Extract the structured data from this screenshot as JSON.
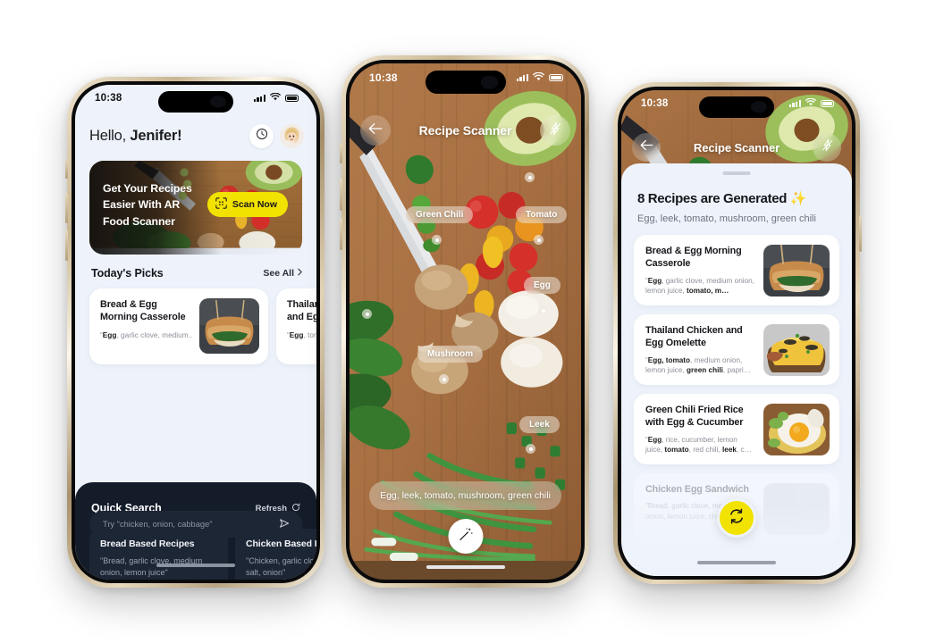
{
  "status_bar": {
    "time": "10:38",
    "signal_icon": "cellular-bars-icon",
    "wifi_icon": "wifi-icon",
    "battery_icon": "battery-icon"
  },
  "phone1": {
    "greeting_prefix": "Hello, ",
    "greeting_name": "Jenifer!",
    "history_icon": "clock-icon",
    "avatar": "user-avatar",
    "banner": {
      "line1": "Get Your Recipes",
      "line2": "Easier With AR",
      "line3": "Food Scanner",
      "cta_label": "Scan Now",
      "cta_icon": "scan-frame-icon",
      "cta_color": "#F2E200"
    },
    "todays_picks": {
      "title": "Today's Picks",
      "see_all": "See All",
      "chevron_icon": "chevron-right-icon",
      "cards": [
        {
          "title": "Bread & Egg Morning Casserole",
          "ingredients_pre": "\"",
          "ingredients_bold": "Egg",
          "ingredients_rest": ", garlic clove, medium…"
        },
        {
          "title": "Thailand Chicken and Egg Omelette",
          "ingredients_pre": "\"",
          "ingredients_bold": "Egg",
          "ingredients_rest": ", tomato, medium…"
        }
      ]
    },
    "quick_search": {
      "title": "Quick Search",
      "refresh_label": "Refresh",
      "refresh_icon": "refresh-icon",
      "cards": [
        {
          "title": "Bread Based Recipes",
          "desc": "\"Bread, garlic clove, medium onion, lemon juice\""
        },
        {
          "title": "Chicken Based Recipes",
          "desc": "\"Chicken, garlic clove, paprika, salt, onion\""
        }
      ],
      "input_placeholder": "Try \"chicken, onion, cabbage\"",
      "send_icon": "send-icon"
    }
  },
  "phone2": {
    "title": "Recipe Scanner",
    "back_icon": "arrow-left-icon",
    "flash_icon": "flash-off-icon",
    "tags": [
      "Green Chili",
      "Tomato",
      "Egg",
      "Mushroom",
      "Leek"
    ],
    "summary": "Egg, leek, tomato, mushroom, green chili",
    "action_icon": "magic-wand-icon"
  },
  "phone3": {
    "title": "Recipe Scanner",
    "back_icon": "arrow-left-icon",
    "flash_icon": "flash-off-icon",
    "results_title": "8 Recipes are Generated ✨",
    "results_subtitle": "Egg, leek, tomato, mushroom, green chili",
    "regenerate_icon": "regenerate-icon",
    "regenerate_color": "#F2E200",
    "recipes": [
      {
        "title": "Bread & Egg Morning Casserole",
        "seg": [
          [
            "\"",
            0
          ],
          [
            "Egg",
            1
          ],
          [
            ", garlic clove, medium onion, lemon juice, ",
            0
          ],
          [
            "tomato, m…",
            1
          ]
        ]
      },
      {
        "title": "Thailand Chicken and Egg Omelette",
        "seg": [
          [
            "\"",
            0
          ],
          [
            "Egg, tomato",
            1
          ],
          [
            ", medium onion, lemon juice, ",
            0
          ],
          [
            "green chili",
            1
          ],
          [
            ", papri…",
            0
          ]
        ]
      },
      {
        "title": "Green Chili Fried Rice with Egg & Cucumber",
        "seg": [
          [
            "\"",
            0
          ],
          [
            "Egg",
            1
          ],
          [
            ", rice, cucumber, lemon juice, ",
            0
          ],
          [
            "tomato",
            1
          ],
          [
            ", red chili, ",
            0
          ],
          [
            "leek",
            1
          ],
          [
            ", c…",
            0
          ]
        ]
      },
      {
        "title": "Chicken Egg Sandwich",
        "seg": [
          [
            "\"Bread, garlic clove, medium onion, lemon juice, chick…",
            0
          ]
        ]
      }
    ]
  }
}
